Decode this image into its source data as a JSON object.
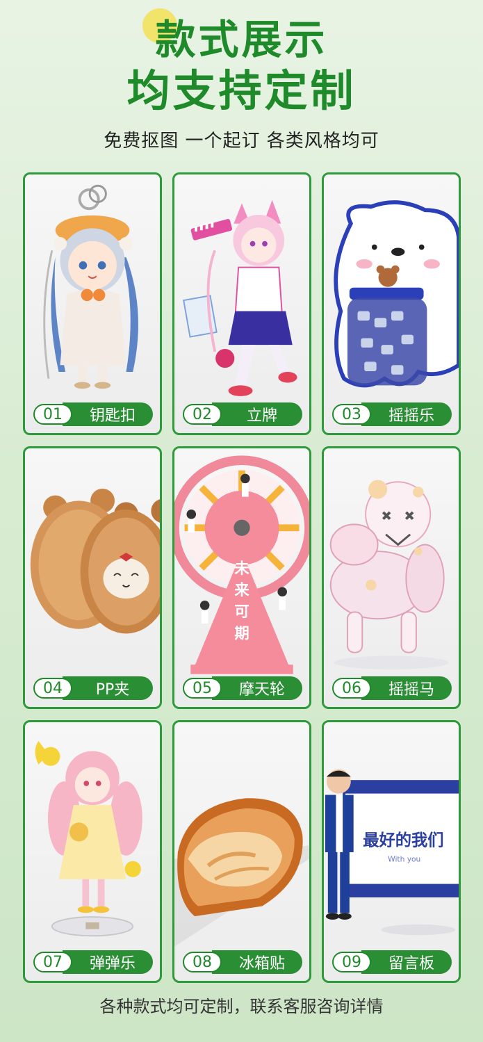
{
  "header": {
    "title_line1": "款式展示",
    "title_line2": "均支持定制",
    "subtitle": "免费抠图 一个起订 各类风格均可"
  },
  "items": [
    {
      "num": "01",
      "name": "钥匙扣"
    },
    {
      "num": "02",
      "name": "立牌"
    },
    {
      "num": "03",
      "name": "摇摇乐"
    },
    {
      "num": "04",
      "name": "PP夹"
    },
    {
      "num": "05",
      "name": "摩天轮"
    },
    {
      "num": "06",
      "name": "摇摇马"
    },
    {
      "num": "07",
      "name": "弹弹乐"
    },
    {
      "num": "08",
      "name": "冰箱贴"
    },
    {
      "num": "09",
      "name": "留言板"
    }
  ],
  "artwork_text": {
    "ferris_sign": "未来可期",
    "board_text": "最好的我们",
    "board_sub": "With you"
  },
  "footer": "各种款式均可定制，联系客服咨询详情",
  "colors": {
    "accent": "#2a8e34",
    "title": "#1f8a2a",
    "dot": "#f2e36a"
  }
}
